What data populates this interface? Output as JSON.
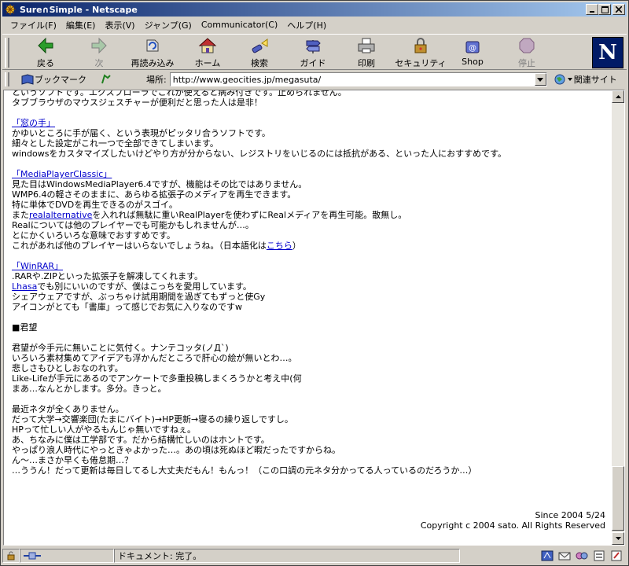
{
  "window": {
    "title": "Sure∩Simple - Netscape"
  },
  "menu": [
    "ファイル(F)",
    "編集(E)",
    "表示(V)",
    "ジャンプ(G)",
    "Communicator(C)",
    "ヘルプ(H)"
  ],
  "toolbar": {
    "back": "戻る",
    "forward": "次",
    "reload": "再読み込み",
    "home": "ホーム",
    "search": "検索",
    "guide": "ガイド",
    "print": "印刷",
    "security": "セキュリティ",
    "shop": "Shop",
    "stop": "停止",
    "logo": "N"
  },
  "location": {
    "bookmark_label": "ブックマーク",
    "location_label": "場所:",
    "url": "http://www.geocities.jp/megasuta/",
    "related_label": "関連サイト"
  },
  "content": {
    "intro": [
      "というソフトです。エクスプローラでこれが使えると病み付きです。止められません。",
      "タブブラウザのマウスジェスチャーが便利だと思った人は是非！"
    ],
    "software": [
      {
        "name": "「窓の手」",
        "lines": [
          "かゆいところに手が届く、という表現がピッタリ合うソフトです。",
          "細々とした設定がこれ一つで全部できてしまいます。",
          "windowsをカスタマイズしたいけどやり方が分からない、レジストリをいじるのには抵抗がある、といった人におすすめです。"
        ]
      },
      {
        "name": "「MediaPlayerClassic」",
        "lines": [
          "見た目はWindowsMediaPlayer6.4ですが、機能はその比ではありません。",
          "WMP6.4の軽さそのままに、あらゆる拡張子のメディアを再生できます。",
          "特に単体でDVDを再生できるのがスゴイ。"
        ],
        "realalt_pre": "また",
        "realalt_link": "realalternative",
        "realalt_post": "を入れれば無駄に重いRealPlayerを使わずにRealメディアを再生可能。散無し。",
        "lines2": [
          "Realについては他のプレイヤーでも可能かもしれませんが…。",
          "とにかくいろいろな意味でおすすめです。"
        ],
        "jp_pre": "これがあれば他のプレイヤーはいらないでしょうね。（日本語化は",
        "jp_link": "こちら",
        "jp_post": "）"
      },
      {
        "name": "「WinRAR」",
        "line1": ".RARや.ZIPといった拡張子を解凍してくれます。",
        "lhasa_link": "Lhasa",
        "lhasa_post": "でも別にいいのですが、僕はこっちを愛用しています。",
        "lines": [
          "シェアウェアですが、ぶっちゃけ試用期間を過ぎてもずっと使Gy",
          "アイコンがとても「書庫」って感じでお気に入りなのですw"
        ]
      }
    ],
    "section_title": "■君望",
    "para1": [
      "君望が今手元に無いことに気付く。ナンテコッタ(ノД`)",
      "いろいろ素材集めてアイデアも浮かんだところで肝心の絵が無いとわ…。",
      "悲しさもひとしおなのれす。",
      "Like-Lifeが手元にあるのでアンケートで多重投稿しまくろうかと考え中(何",
      "まあ…なんとかします。多分。きっと。"
    ],
    "para2": [
      "最近ネタが全くありません。",
      "だって大学→交響楽団(たまにバイト)→HP更新→寝るの繰り返しですし。",
      "HPって忙しい人がやるもんじゃ無いですねぇ。",
      "あ、ちなみに僕は工学部です。だから結構忙しいのはホントです。",
      "やっぱり浪人時代にやっときゃよかった…。あの頃は死ぬほど暇だったですからね。",
      "ん〜…まさか早くも倦怠期…？",
      "…ううん！だって更新は毎日してるし大丈夫だもん！もんっ！（この口調の元ネタ分かってる人っているのだろうか…）"
    ],
    "footer": [
      "Since 2004 5/24",
      "Copyright c 2004 sato. All Rights Reserved"
    ]
  },
  "status": {
    "text": "ドキュメント: 完了。"
  }
}
